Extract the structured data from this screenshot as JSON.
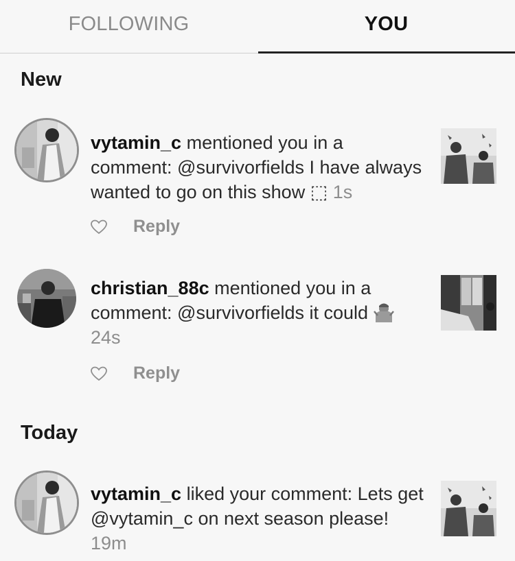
{
  "tabs": {
    "following_label": "FOLLOWING",
    "you_label": "YOU",
    "active": "YOU"
  },
  "sections": {
    "new_label": "New",
    "today_label": "Today"
  },
  "notifications": [
    {
      "username": "vytamin_c",
      "message": " mentioned you in a comment: @survivorfields I have always wanted to go on this show ⬚ ",
      "time": "1s",
      "reply_label": "Reply",
      "avatar_icon": "profile-photo",
      "thumbnail_icon": "post-thumbnail"
    },
    {
      "username": "christian_88c",
      "message": " mentioned you in a comment: @survivorfields it could ",
      "emoji_icon": "man-shrugging-emoji",
      "time": "24s",
      "reply_label": "Reply",
      "avatar_icon": "profile-photo",
      "thumbnail_icon": "post-thumbnail"
    },
    {
      "username": "vytamin_c",
      "message": " liked your comment: Lets get @vytamin_c on next season please! ",
      "time": "19m",
      "avatar_icon": "profile-photo",
      "thumbnail_icon": "post-thumbnail"
    }
  ],
  "colors": {
    "background": "#f7f7f7",
    "text": "#1e1e1e",
    "muted": "#8d8d8d",
    "inactive_tab": "#8a8a8a"
  }
}
